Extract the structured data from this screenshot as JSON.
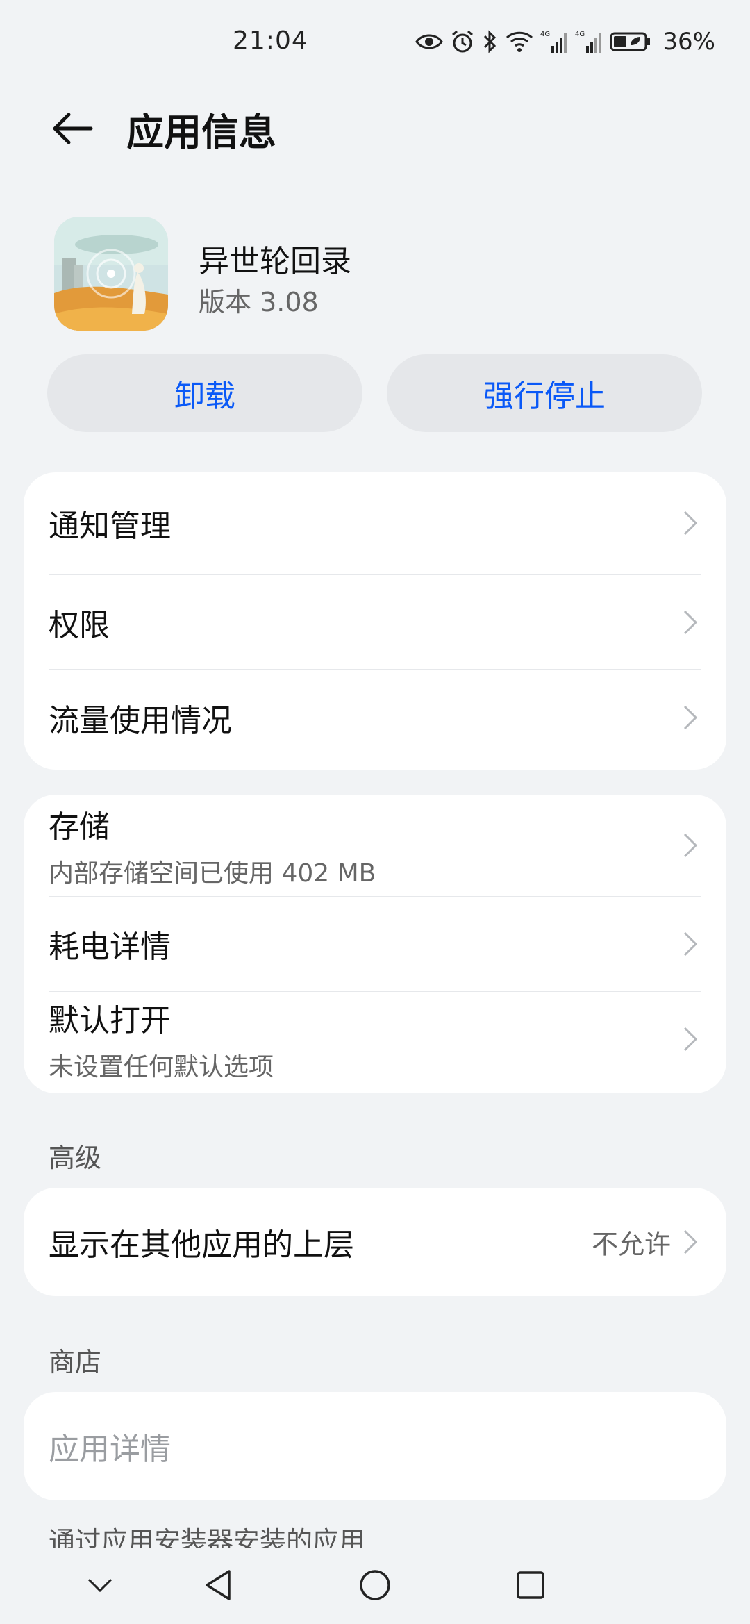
{
  "status_bar": {
    "time": "21:04",
    "battery": "36%",
    "icons": [
      "eye-icon",
      "alarm-icon",
      "bluetooth-icon",
      "wifi-icon",
      "signal-4g-icon",
      "signal-4g-icon",
      "battery-icon"
    ]
  },
  "header": {
    "title": "应用信息"
  },
  "app": {
    "name": "异世轮回录",
    "version": "版本 3.08"
  },
  "actions": {
    "uninstall": "卸载",
    "force_stop": "强行停止"
  },
  "card1": {
    "items": [
      {
        "title": "通知管理"
      },
      {
        "title": "权限"
      },
      {
        "title": "流量使用情况"
      }
    ]
  },
  "card2": {
    "storage": {
      "title": "存储",
      "subtitle": "内部存储空间已使用 402 MB"
    },
    "battery": {
      "title": "耗电详情"
    },
    "default_open": {
      "title": "默认打开",
      "subtitle": "未设置任何默认选项"
    }
  },
  "advanced": {
    "label": "高级",
    "overlay": {
      "title": "显示在其他应用的上层",
      "value": "不允许"
    }
  },
  "store": {
    "label": "商店",
    "details": {
      "title": "应用详情"
    }
  },
  "footer_text": "通过应用安装器安装的应用",
  "colors": {
    "accent": "#0a59f7",
    "background": "#f1f3f5",
    "card": "#ffffff",
    "button_bg": "#e5e7ea"
  }
}
